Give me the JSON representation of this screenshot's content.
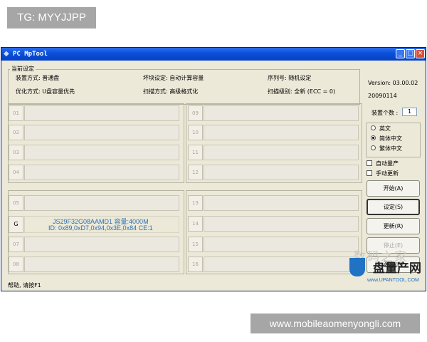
{
  "overlay": {
    "tag": "TG: MYYJJPP",
    "watermark": "www.mobileaomenyongli.com"
  },
  "window": {
    "title": "PC MpTool"
  },
  "settings": {
    "group_title": "当前设定",
    "device_mode": "装置方式: 普通盘",
    "bad_block": "坏块设定: 自动计算容量",
    "serial": "序列号: 随机设定",
    "optimize": "优化方式: U盘容量优先",
    "scan_mode": "扫描方式: 高级格式化",
    "scan_level": "扫描级别: 全新 (ECC = 0)"
  },
  "side": {
    "version": "Version: 03.00.02",
    "date": "20090114",
    "count_label": "装置个数 :",
    "count_value": "1",
    "lang_en": "英文",
    "lang_sc": "简体中文",
    "lang_tc": "繁体中文",
    "lang_selected": "简体中文",
    "auto_mp": "自动量产",
    "manual_update": "手动更新",
    "start": "开始(A)",
    "settings": "设定(S)",
    "update": "更新(R)",
    "stop": "停止(E)",
    "eject": "弹出(E)"
  },
  "slots_left_top": [
    "01",
    "02",
    "03",
    "04"
  ],
  "slots_right_top": [
    "09",
    "10",
    "11",
    "12"
  ],
  "slots_left_bottom": [
    "05",
    "G",
    "07",
    "08"
  ],
  "slots_right_bottom": [
    "13",
    "14",
    "15",
    "16"
  ],
  "active_device": {
    "line1": "JS29F32G08AAMD1 容量:4000M",
    "line2": "ID: 0x89,0xD7,0x94,0x3E,0x84  CE:1"
  },
  "status": {
    "text": "帮助, 请按F1"
  },
  "logo": {
    "faint": "数码之家",
    "brand": "盘量产网",
    "url": "www.UPANTOOL.COM"
  }
}
